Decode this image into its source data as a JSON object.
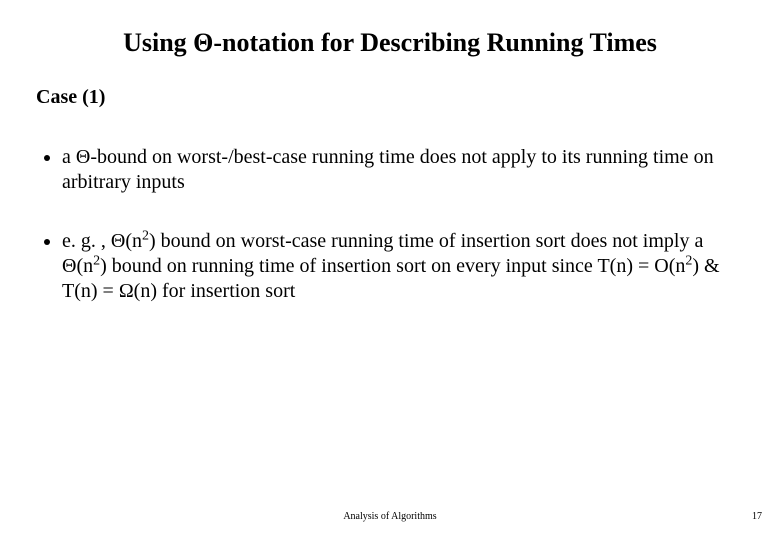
{
  "title": "Using Θ-notation for Describing Running Times",
  "case_label": "Case (1)",
  "bullets": [
    {
      "prefix": "a Θ-bound on worst-/best-case running time does not apply to its running time on arbitrary inputs"
    },
    {
      "p1": "e. g. , Θ(n",
      "sup1": "2",
      "p2": ") bound on worst-case running time of insertion sort does not imply a Θ(n",
      "sup2": "2",
      "p3": ") bound on running time of insertion sort on every input since T(n) = O(n",
      "sup3": "2",
      "p4": ") & T(n) = Ω(n) for insertion sort"
    }
  ],
  "footer": {
    "center": "Analysis of Algorithms",
    "page": "17"
  }
}
